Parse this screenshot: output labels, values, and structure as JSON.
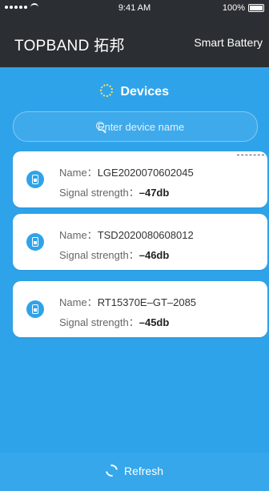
{
  "status_bar": {
    "time": "9:41 AM",
    "battery": "100%"
  },
  "app_bar": {
    "brand": "TOPBAND 拓邦",
    "right_label": "Smart Battery"
  },
  "section": {
    "title": "Devices"
  },
  "search": {
    "placeholder": "Enter device name"
  },
  "labels": {
    "name": "Name：",
    "signal": "Signal strength："
  },
  "devices": [
    {
      "name": "LGE2020070602045",
      "signal": "–47db"
    },
    {
      "name": "TSD2020080608012",
      "signal": "–46db"
    },
    {
      "name": "RT15370E–GT–2085",
      "signal": "–45db"
    }
  ],
  "footer": {
    "refresh_label": "Refresh"
  },
  "colors": {
    "primary": "#2FA3EA",
    "header": "#2b2f33",
    "card": "#ffffff"
  }
}
